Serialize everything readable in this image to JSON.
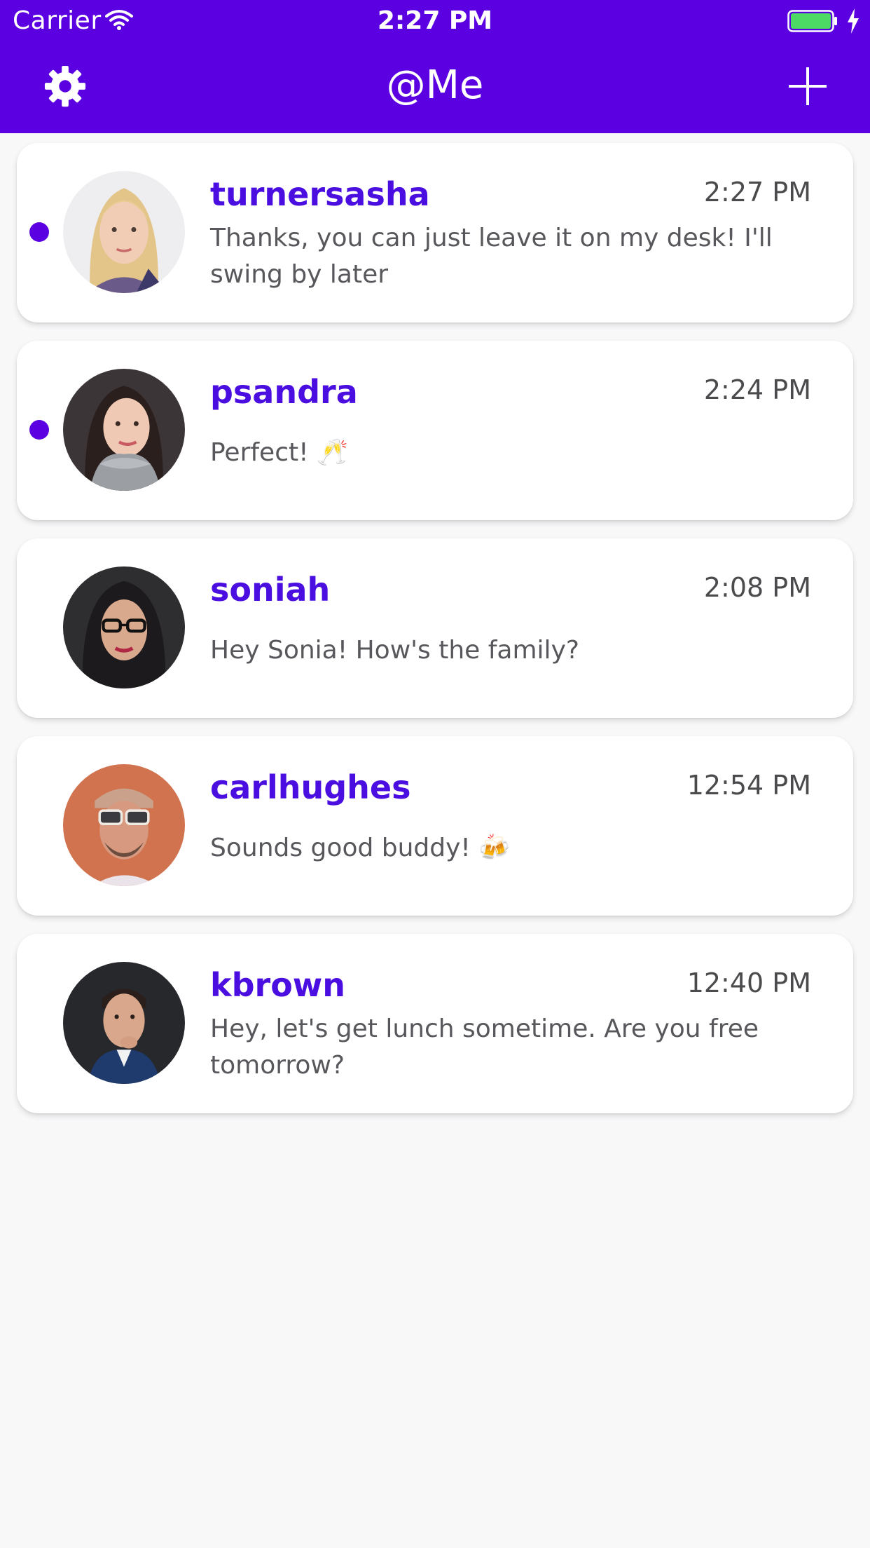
{
  "colors": {
    "brand": "#5b00e0",
    "username": "#4a0ee0",
    "battery": "#4cd964"
  },
  "status_bar": {
    "carrier": "Carrier",
    "time": "2:27 PM"
  },
  "nav": {
    "title": "@Me",
    "left_icon": "gear-icon",
    "right_icon": "plus-icon"
  },
  "conversations": [
    {
      "username": "turnersasha",
      "time": "2:27 PM",
      "message": "Thanks, you can just leave it on my desk! I'll swing by later",
      "unread": true
    },
    {
      "username": "psandra",
      "time": "2:24 PM",
      "message": "Perfect! 🥂",
      "unread": true
    },
    {
      "username": "soniah",
      "time": "2:08 PM",
      "message": "Hey Sonia! How's the family?",
      "unread": false
    },
    {
      "username": "carlhughes",
      "time": "12:54 PM",
      "message": "Sounds good buddy! 🍻",
      "unread": false
    },
    {
      "username": "kbrown",
      "time": "12:40 PM",
      "message": "Hey, let's get lunch sometime. Are you free tomorrow?",
      "unread": false
    }
  ]
}
